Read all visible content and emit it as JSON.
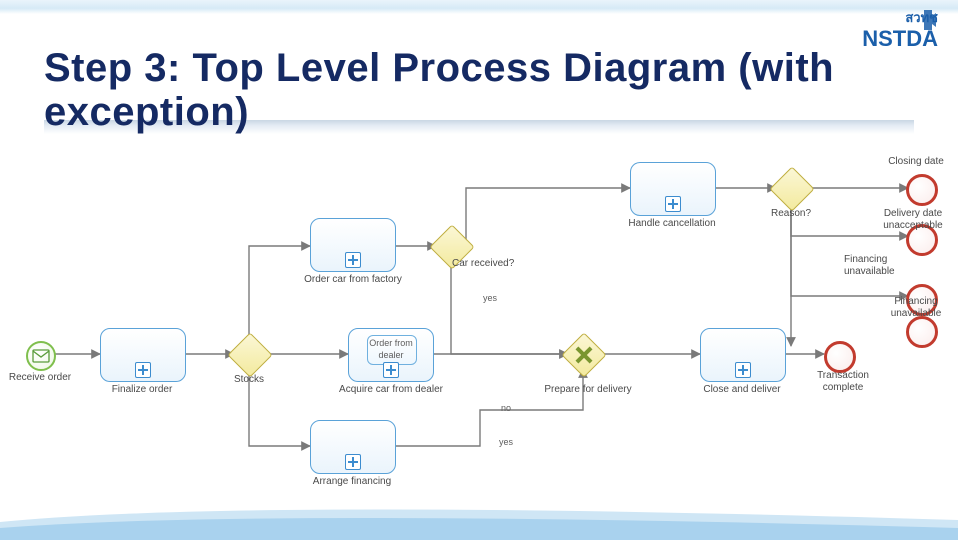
{
  "logo": {
    "top_text": "สวทช",
    "main_text": "NSTDA"
  },
  "title": "Step 3: Top Level Process Diagram (with\nexception)",
  "events": {
    "start": {
      "label": "Receive order"
    },
    "end_closing": {
      "label": "Closing date"
    },
    "end_delivery": {
      "label": "Delivery date\nunacceptable"
    },
    "end_finance1": {
      "label": "Financing\nunavailable"
    },
    "end_finance2": {
      "label": "Financing\nunavailable"
    },
    "end_txn": {
      "label": "Transaction\ncomplete"
    }
  },
  "tasks": {
    "finalize": {
      "label": "Finalize order"
    },
    "order_fac": {
      "label": "Order car from factory"
    },
    "acquire": {
      "label": "Acquire car from dealer",
      "sub_label": "Order from\ndealer"
    },
    "arrange": {
      "label": "Arrange financing"
    },
    "cancel": {
      "label": "Handle cancellation"
    },
    "prepare": {
      "label": "Prepare for delivery"
    },
    "close": {
      "label": "Close and deliver"
    }
  },
  "gateways": {
    "stocks": {
      "label": "Stocks"
    },
    "car_recv": {
      "label": "Car received?"
    },
    "par_in": {
      "label": ""
    },
    "par_out": {
      "label": ""
    },
    "reason": {
      "label": "Reason?"
    }
  },
  "flow_labels": {
    "yes1": "yes",
    "yes2": "yes",
    "no": "no"
  }
}
